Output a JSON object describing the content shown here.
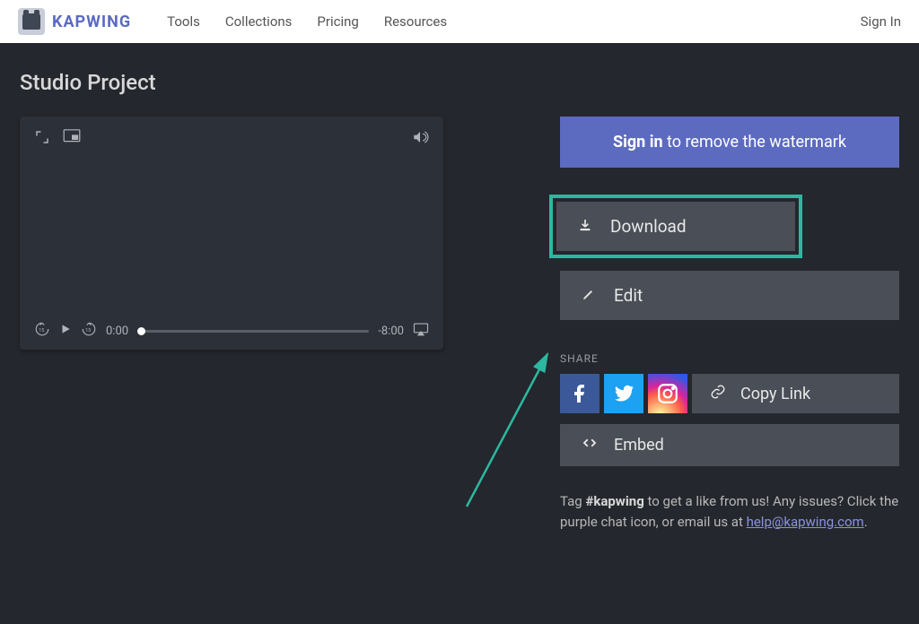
{
  "header": {
    "brand": "KAPWING",
    "nav": [
      "Tools",
      "Collections",
      "Pricing",
      "Resources"
    ],
    "sign_in": "Sign In"
  },
  "page": {
    "title": "Studio Project"
  },
  "player": {
    "current_time": "0:00",
    "remaining_time": "-8:00"
  },
  "actions": {
    "signin_bold": "Sign in",
    "signin_rest": " to remove the watermark",
    "download": "Download",
    "edit": "Edit",
    "share_label": "SHARE",
    "copy_link": "Copy Link",
    "embed": "Embed"
  },
  "footer": {
    "prefix": "Tag ",
    "hashtag": "#kapwing",
    "mid": " to get a like from us! Any issues? Click the purple chat icon, or email us at ",
    "email": "help@kapwing.com",
    "suffix": "."
  }
}
